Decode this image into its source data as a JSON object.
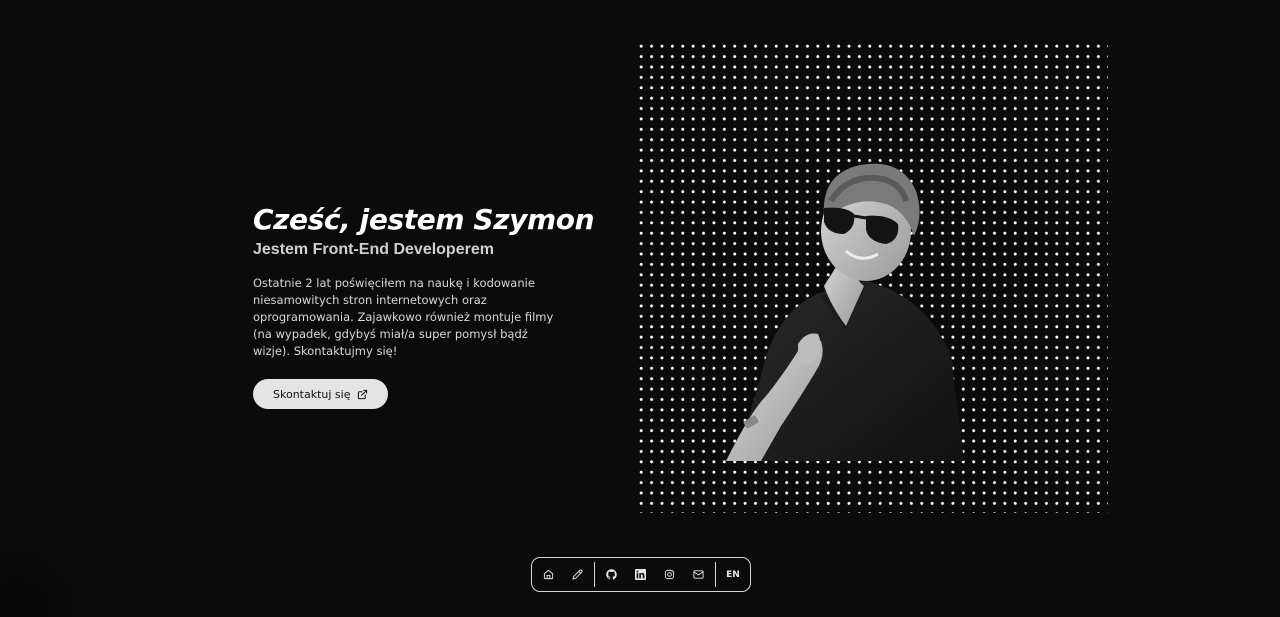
{
  "hero": {
    "title": "Cześć, jestem Szymon",
    "subtitle": "Jestem Front-End Developerem",
    "description": "Ostatnie 2 lat poświęciłem na naukę i kodowanie niesamowitych stron internetowych oraz oprogramowania. Zajawkowo również montuje filmy (na wypadek, gdybyś miał/a super pomysł bądź wizje). Skontaktujmy się!",
    "cta_label": "Skontaktuj się",
    "cta_icon": "external-link-icon"
  },
  "portrait": {
    "style": "grayscale photo over white dot grid"
  },
  "bottom_nav": {
    "items": [
      {
        "icon": "home-icon"
      },
      {
        "icon": "pencil-icon"
      },
      {
        "icon": "github-icon"
      },
      {
        "icon": "linkedin-icon"
      },
      {
        "icon": "instagram-icon"
      },
      {
        "icon": "mail-icon"
      }
    ],
    "language_label": "EN"
  },
  "colors": {
    "background": "#0b0b0c",
    "text": "#e8e8e8",
    "button_bg": "#e4e4e4",
    "dots": "#ffffff"
  }
}
